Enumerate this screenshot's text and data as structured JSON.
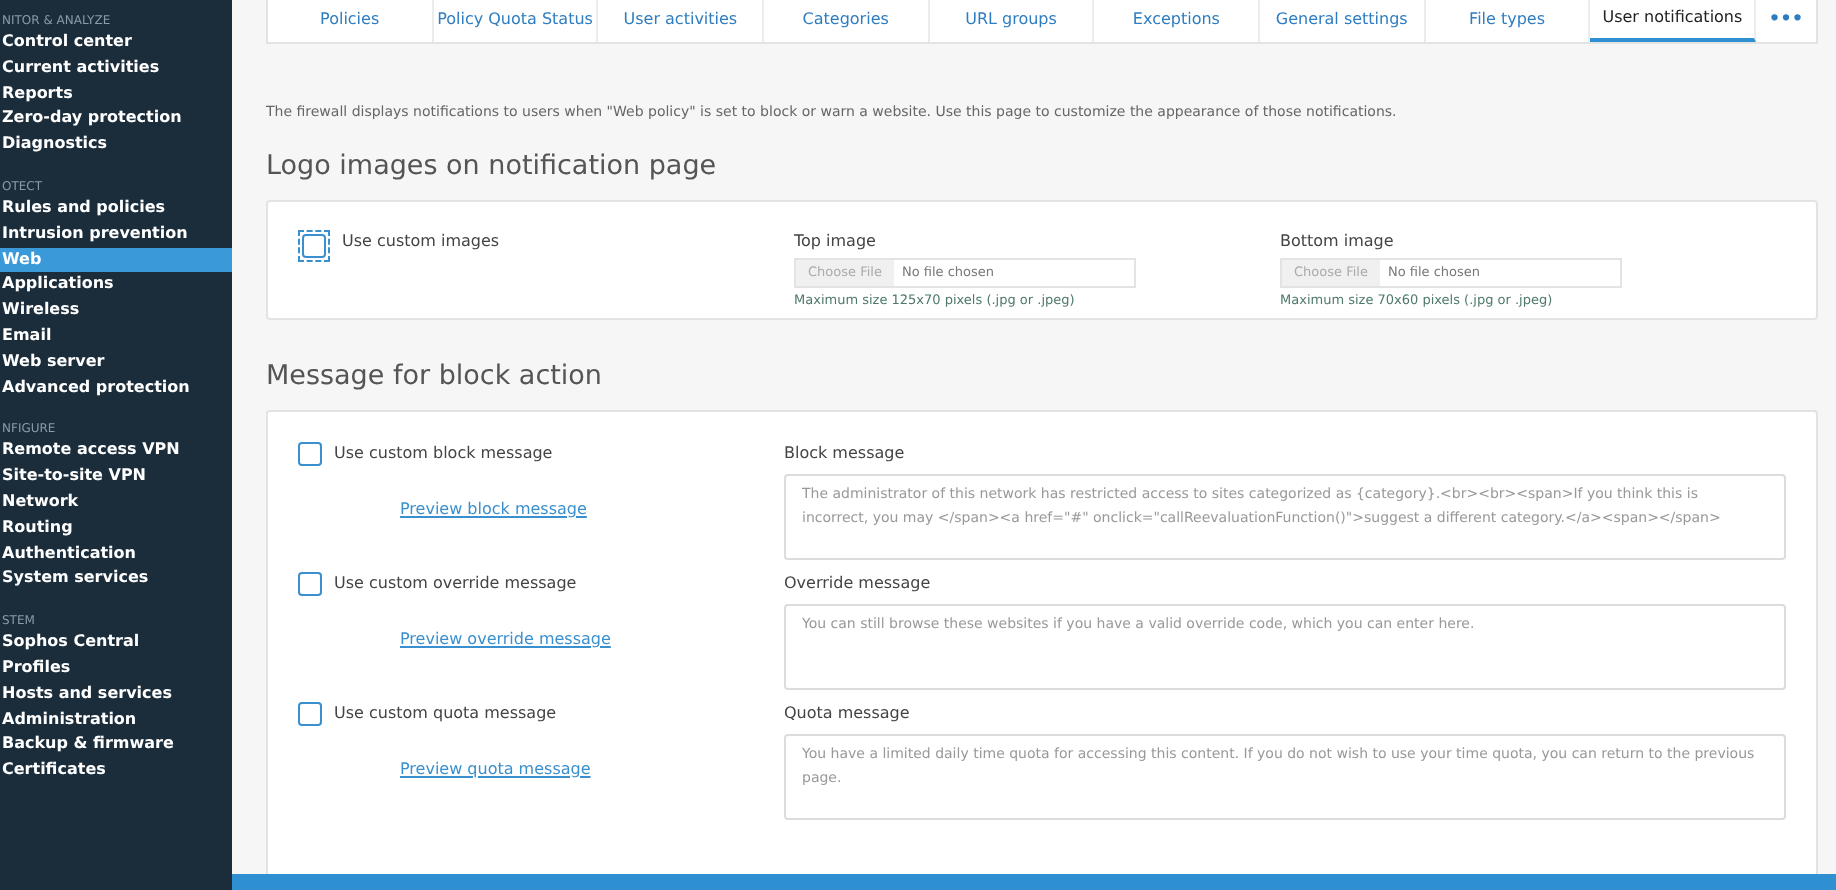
{
  "sidebar": {
    "sections": [
      {
        "heading": "NITOR & ANALYZE",
        "items": [
          {
            "label": "Control center",
            "selected": false
          },
          {
            "label": "Current activities",
            "selected": false
          },
          {
            "label": "Reports",
            "selected": false
          },
          {
            "label": "Zero-day protection",
            "selected": false
          },
          {
            "label": "Diagnostics",
            "selected": false
          }
        ]
      },
      {
        "heading": "OTECT",
        "items": [
          {
            "label": "Rules and policies",
            "selected": false
          },
          {
            "label": "Intrusion prevention",
            "selected": false
          },
          {
            "label": "Web",
            "selected": true
          },
          {
            "label": "Applications",
            "selected": false
          },
          {
            "label": "Wireless",
            "selected": false
          },
          {
            "label": "Email",
            "selected": false
          },
          {
            "label": "Web server",
            "selected": false
          },
          {
            "label": "Advanced protection",
            "selected": false
          }
        ]
      },
      {
        "heading": "NFIGURE",
        "items": [
          {
            "label": "Remote access VPN",
            "selected": false
          },
          {
            "label": "Site-to-site VPN",
            "selected": false
          },
          {
            "label": "Network",
            "selected": false
          },
          {
            "label": "Routing",
            "selected": false
          },
          {
            "label": "Authentication",
            "selected": false
          },
          {
            "label": "System services",
            "selected": false
          }
        ]
      },
      {
        "heading": "STEM",
        "items": [
          {
            "label": "Sophos Central",
            "selected": false
          },
          {
            "label": "Profiles",
            "selected": false
          },
          {
            "label": "Hosts and services",
            "selected": false
          },
          {
            "label": "Administration",
            "selected": false
          },
          {
            "label": "Backup & firmware",
            "selected": false
          },
          {
            "label": "Certificates",
            "selected": false
          }
        ]
      }
    ]
  },
  "tabs": [
    {
      "label": "Policies",
      "selected": false
    },
    {
      "label": "Policy Quota Status",
      "selected": false
    },
    {
      "label": "User activities",
      "selected": false
    },
    {
      "label": "Categories",
      "selected": false
    },
    {
      "label": "URL groups",
      "selected": false
    },
    {
      "label": "Exceptions",
      "selected": false
    },
    {
      "label": "General settings",
      "selected": false
    },
    {
      "label": "File types",
      "selected": false
    },
    {
      "label": "User notifications",
      "selected": true
    }
  ],
  "tabs_more": "•••",
  "intro": "The firewall displays notifications to users when \"Web policy\" is set to block or warn a website. Use this page to customize the appearance of those notifications.",
  "logo_section": {
    "title": "Logo images on notification page",
    "checkbox": {
      "label": "Use custom images",
      "checked": false,
      "focused": true
    },
    "uploads": [
      {
        "label": "Top image",
        "button": "Choose File",
        "status": "No file chosen",
        "hint": "Maximum size 125x70 pixels (.jpg or .jpeg)"
      },
      {
        "label": "Bottom image",
        "button": "Choose File",
        "status": "No file chosen",
        "hint": "Maximum size 70x60 pixels (.jpg or .jpeg)"
      }
    ]
  },
  "block_section": {
    "title": "Message for block action",
    "rows": [
      {
        "checkbox": {
          "label": "Use custom block message",
          "checked": false
        },
        "link": "Preview block message",
        "field_label": "Block message",
        "placeholder": "The administrator of this network has restricted access to sites categorized as {category}.<br><br><span>If you think this is incorrect, you may </span><a href=\"#\" onclick=\"callReevaluationFunction()\">suggest a different category.</a><span></span>"
      },
      {
        "checkbox": {
          "label": "Use custom override message",
          "checked": false
        },
        "link": "Preview override message",
        "field_label": "Override message",
        "placeholder": "You can still browse these websites if you have a valid override code, which you can enter here."
      },
      {
        "checkbox": {
          "label": "Use custom quota message",
          "checked": false
        },
        "link": "Preview quota message",
        "field_label": "Quota message",
        "placeholder": "You have a limited daily time quota for accessing this content. If you do not wish to use your time quota, you can return to the previous page."
      }
    ]
  }
}
